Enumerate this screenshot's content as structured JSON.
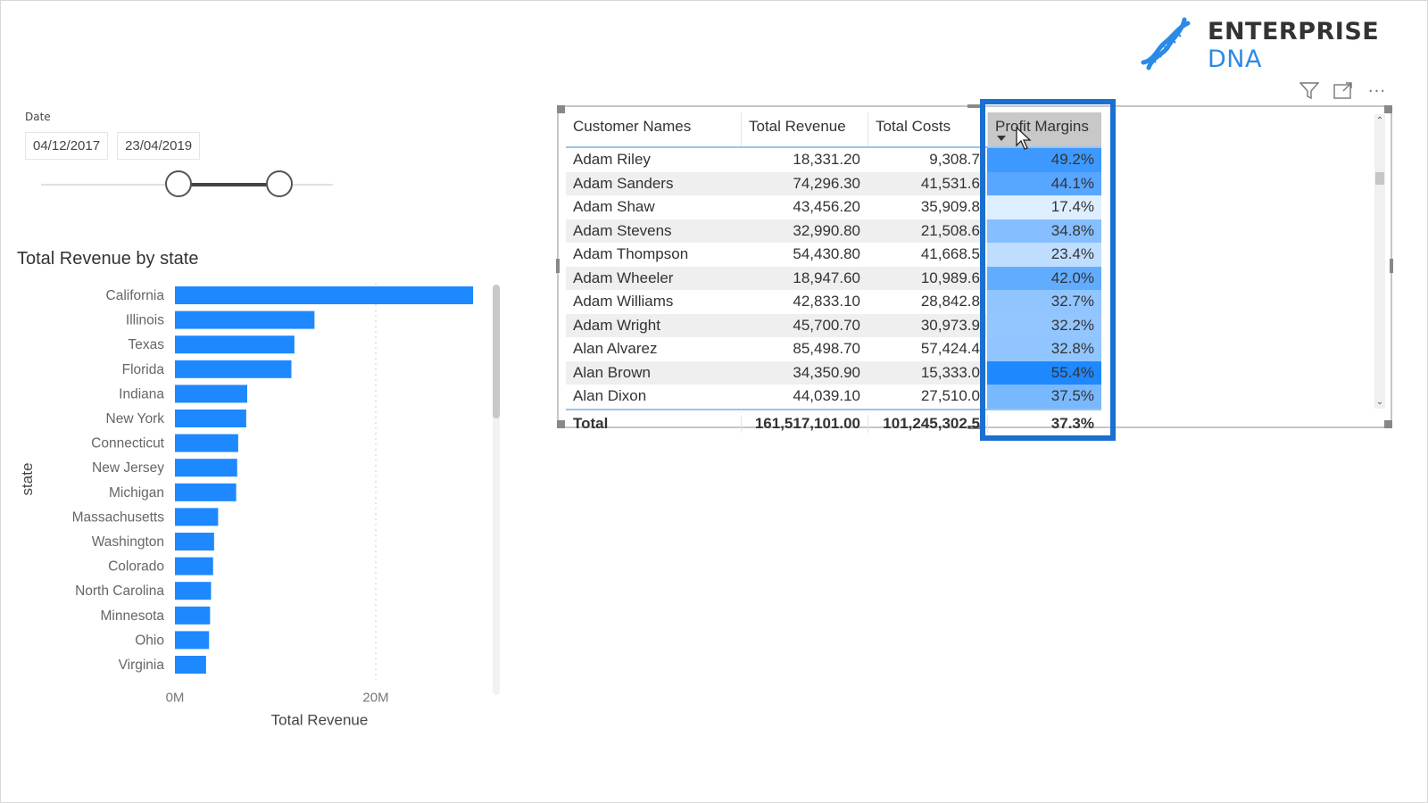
{
  "logo": {
    "brand_main": "ENTERPRISE",
    "brand_accent": "DNA",
    "icon": "dna-helix-icon",
    "accent_color": "#2b8ae6"
  },
  "visual_header": {
    "icons": [
      "filter-icon",
      "focus-mode-icon",
      "more-options-icon"
    ],
    "more_label": "···"
  },
  "slicer": {
    "title": "Date",
    "start_date": "04/12/2017",
    "end_date": "23/04/2019"
  },
  "chart_data": {
    "type": "bar",
    "orientation": "horizontal",
    "title": "Total Revenue by state",
    "xlabel": "Total Revenue",
    "ylabel": "state",
    "xlim": [
      0,
      30000000
    ],
    "x_ticks": [
      "0M",
      "20M"
    ],
    "x_tick_values": [
      0,
      20000000
    ],
    "grid": true,
    "bar_color": "#1e88ff",
    "categories": [
      "California",
      "Illinois",
      "Texas",
      "Florida",
      "Indiana",
      "New York",
      "Connecticut",
      "New Jersey",
      "Michigan",
      "Massachusetts",
      "Washington",
      "Colorado",
      "North Carolina",
      "Minnesota",
      "Ohio",
      "Virginia"
    ],
    "values": [
      29700000,
      13900000,
      11900000,
      11600000,
      7200000,
      7100000,
      6300000,
      6200000,
      6100000,
      4300000,
      3900000,
      3800000,
      3600000,
      3500000,
      3400000,
      3100000
    ]
  },
  "table": {
    "columns": [
      "Customer Names",
      "Total Revenue",
      "Total Costs",
      "Profit Margins"
    ],
    "rows": [
      {
        "name": "Adam Riley",
        "revenue": "18,331.20",
        "costs": "9,308.7",
        "margin": "49.2%",
        "margin_value": 49.2
      },
      {
        "name": "Adam Sanders",
        "revenue": "74,296.30",
        "costs": "41,531.6",
        "margin": "44.1%",
        "margin_value": 44.1
      },
      {
        "name": "Adam Shaw",
        "revenue": "43,456.20",
        "costs": "35,909.8",
        "margin": "17.4%",
        "margin_value": 17.4
      },
      {
        "name": "Adam Stevens",
        "revenue": "32,990.80",
        "costs": "21,508.6",
        "margin": "34.8%",
        "margin_value": 34.8
      },
      {
        "name": "Adam Thompson",
        "revenue": "54,430.80",
        "costs": "41,668.5",
        "margin": "23.4%",
        "margin_value": 23.4
      },
      {
        "name": "Adam Wheeler",
        "revenue": "18,947.60",
        "costs": "10,989.6",
        "margin": "42.0%",
        "margin_value": 42.0
      },
      {
        "name": "Adam Williams",
        "revenue": "42,833.10",
        "costs": "28,842.8",
        "margin": "32.7%",
        "margin_value": 32.7
      },
      {
        "name": "Adam Wright",
        "revenue": "45,700.70",
        "costs": "30,973.9",
        "margin": "32.2%",
        "margin_value": 32.2
      },
      {
        "name": "Alan Alvarez",
        "revenue": "85,498.70",
        "costs": "57,424.4",
        "margin": "32.8%",
        "margin_value": 32.8
      },
      {
        "name": "Alan Brown",
        "revenue": "34,350.90",
        "costs": "15,333.0",
        "margin": "55.4%",
        "margin_value": 55.4
      },
      {
        "name": "Alan Dixon",
        "revenue": "44,039.10",
        "costs": "27,510.0",
        "margin": "37.5%",
        "margin_value": 37.5
      }
    ],
    "total": {
      "label": "Total",
      "revenue": "161,517,101.00",
      "costs": "101,245,302.5",
      "margin": "37.3%"
    },
    "highlight_color": "#1a6fd0",
    "margin_scale_colors": {
      "low": "#ddeeff",
      "high": "#1e88ff"
    }
  }
}
